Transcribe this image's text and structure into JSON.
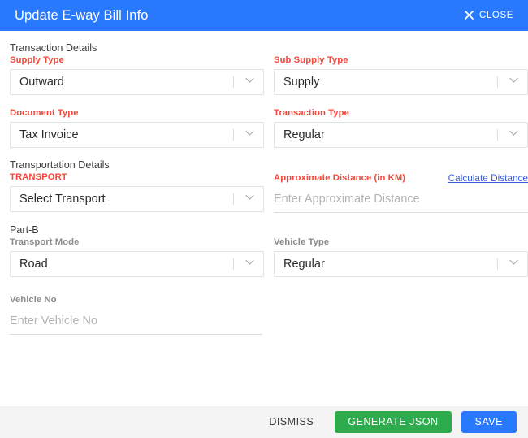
{
  "titlebar": {
    "title": "Update E-way Bill Info",
    "close_label": "CLOSE",
    "close_icon": "close-icon",
    "bg_color": "#2979ff"
  },
  "sections": {
    "transaction_details": "Transaction Details",
    "transportation_details": "Transportation Details",
    "part_b": "Part-B"
  },
  "fields": {
    "supply_type": {
      "label": "Supply Type",
      "value": "Outward",
      "required_color": "#f4483c"
    },
    "sub_supply_type": {
      "label": "Sub Supply Type",
      "value": "Supply",
      "required_color": "#f4483c"
    },
    "document_type": {
      "label": "Document Type",
      "value": "Tax Invoice",
      "required_color": "#f4483c"
    },
    "transaction_type": {
      "label": "Transaction Type",
      "value": "Regular",
      "required_color": "#f4483c"
    },
    "transport": {
      "label": "TRANSPORT",
      "value": "Select Transport",
      "required_color": "#f4483c"
    },
    "approx_distance": {
      "label": "Approximate Distance (in KM)",
      "placeholder": "Enter Approximate Distance",
      "value": "",
      "link_label": "Calculate Distance",
      "link_color": "#3b5ddb"
    },
    "transport_mode": {
      "label": "Transport Mode",
      "value": "Road",
      "label_color": "#8a8a8a"
    },
    "vehicle_type": {
      "label": "Vehicle Type",
      "value": "Regular",
      "label_color": "#8a8a8a"
    },
    "vehicle_no": {
      "label": "Vehicle No",
      "placeholder": "Enter Vehicle No",
      "value": "",
      "label_color": "#8a8a8a"
    }
  },
  "footer": {
    "dismiss_label": "DISMISS",
    "generate_json_label": "GENERATE JSON",
    "save_label": "SAVE",
    "generate_color": "#2eab4d",
    "save_color": "#2979ff",
    "bg_color": "#f4f4f4"
  }
}
